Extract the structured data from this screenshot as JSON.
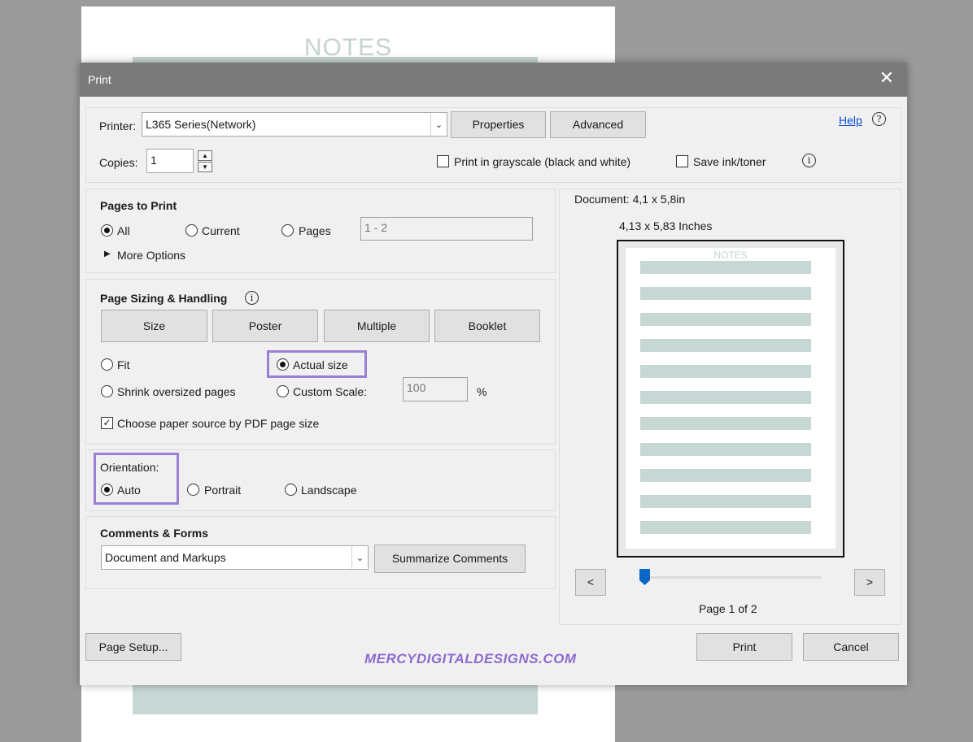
{
  "background_doc": {
    "title": "NOTES"
  },
  "dialog": {
    "title": "Print",
    "close_glyph": "✕",
    "printer": {
      "label": "Printer:",
      "value": "L365 Series(Network)",
      "properties_label": "Properties",
      "advanced_label": "Advanced",
      "help_label": "Help"
    },
    "copies": {
      "label": "Copies:",
      "value": "1"
    },
    "grayscale": {
      "label": "Print in grayscale (black and white)",
      "checked": false
    },
    "save_ink": {
      "label": "Save ink/toner",
      "checked": false
    },
    "pages_to_print": {
      "heading": "Pages to Print",
      "all_label": "All",
      "current_label": "Current",
      "pages_label": "Pages",
      "pages_range": "1 - 2",
      "selected": "All",
      "more_options": "More Options"
    },
    "page_sizing": {
      "heading": "Page Sizing & Handling",
      "buttons": [
        "Size",
        "Poster",
        "Multiple",
        "Booklet"
      ],
      "fit_label": "Fit",
      "actual_size_label": "Actual size",
      "shrink_label": "Shrink oversized pages",
      "custom_scale_label": "Custom Scale:",
      "custom_scale_value": "100",
      "percent": "%",
      "selected": "Actual size",
      "paper_source_label": "Choose paper source by PDF page size",
      "paper_source_checked": true
    },
    "orientation": {
      "heading": "Orientation:",
      "auto_label": "Auto",
      "portrait_label": "Portrait",
      "landscape_label": "Landscape",
      "selected": "Auto"
    },
    "comments_forms": {
      "heading": "Comments & Forms",
      "value": "Document and Markups",
      "summarize_label": "Summarize Comments"
    },
    "preview": {
      "document_size": "Document: 4,1 x 5,8in",
      "page_size": "4,13 x 5,83 Inches",
      "thumb_title": "NOTES",
      "prev_label": "<",
      "next_label": ">",
      "page_indicator": "Page 1 of 2",
      "page_current": 1,
      "page_total": 2
    },
    "page_setup_label": "Page Setup...",
    "print_label": "Print",
    "cancel_label": "Cancel",
    "watermark": "MERCYDIGITALDESIGNS.COM",
    "highlight_color": "#9b7fd4",
    "accent_color": "#0a67c7"
  }
}
